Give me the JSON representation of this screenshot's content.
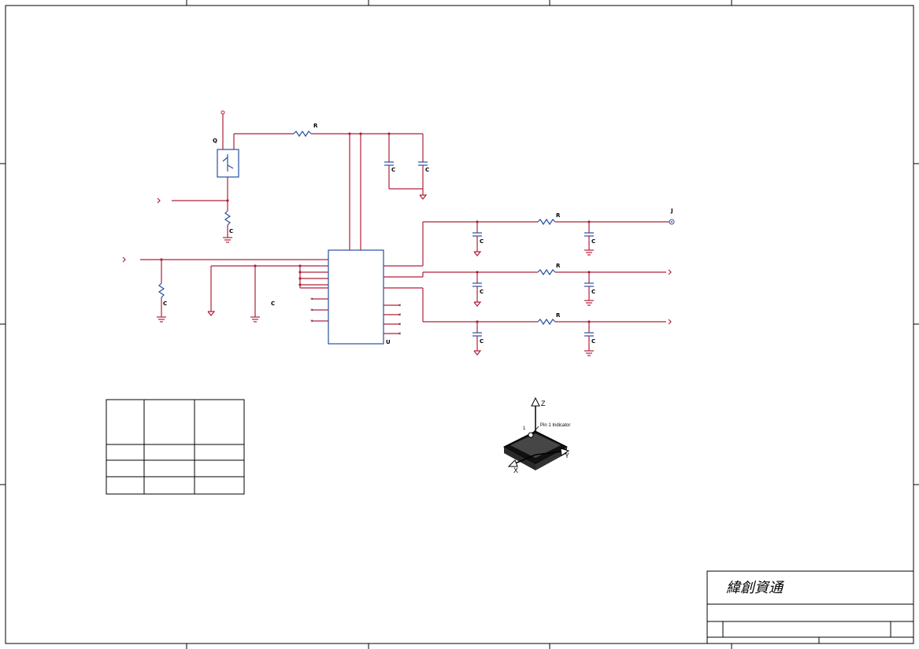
{
  "title_block": {
    "company": "緯創資通"
  },
  "component_tags": {
    "transistor": "Q",
    "top_resistor": "R",
    "bias_resistor": "C",
    "decoupling_cap_1": "C",
    "decoupling_cap_2": "C",
    "input_resistor": "C",
    "ground_cap": "C",
    "ic": "U",
    "output_resistor_1": "R",
    "output_resistor_2": "R",
    "output_resistor_3": "R",
    "output_cap": "C",
    "connector": "J"
  },
  "package_view": {
    "axis_z": "Z",
    "axis_y": "Y",
    "axis_x": "X",
    "pin_number": "1",
    "pin_indicator": "Pin 1 Indicator"
  },
  "colors": {
    "wire": "#b0203a",
    "component": "#2850a0",
    "frame": "#000000"
  }
}
